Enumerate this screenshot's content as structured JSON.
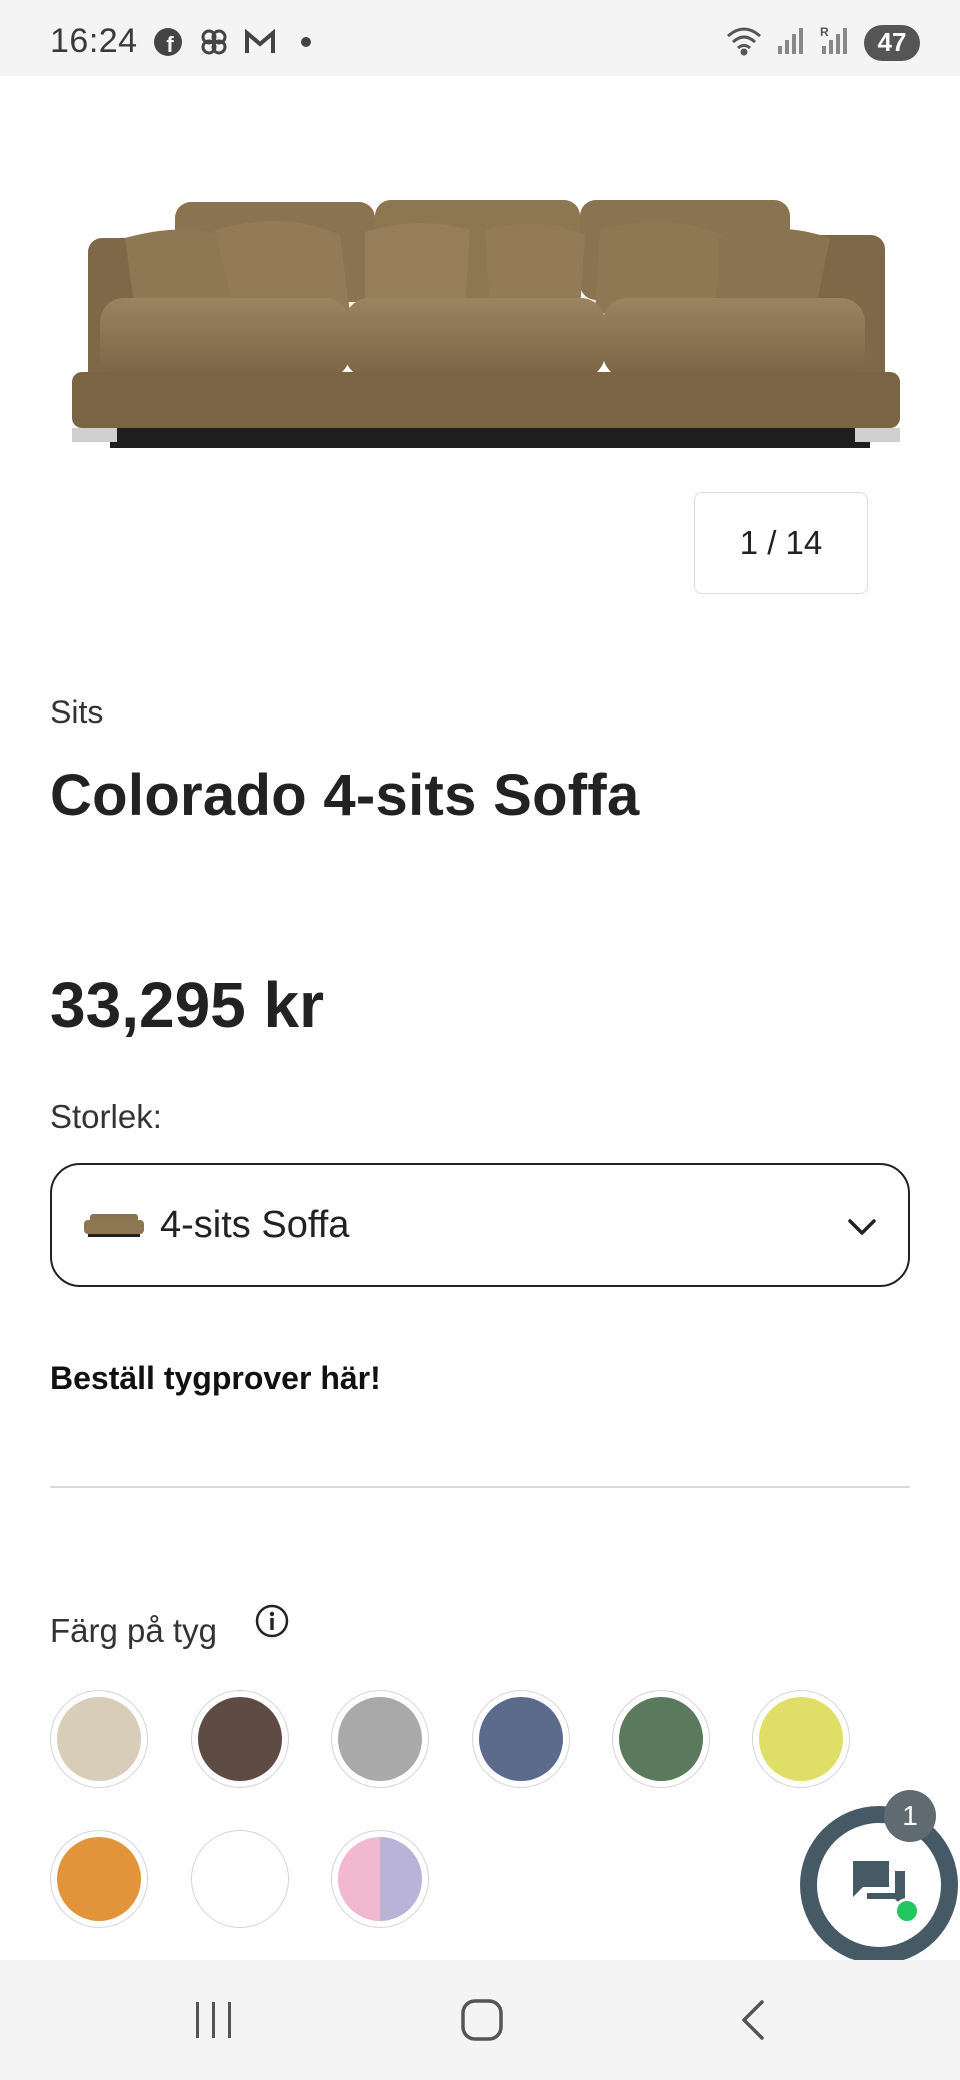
{
  "status_bar": {
    "time": "16:24",
    "left_icons": [
      "facebook-icon",
      "pinwheel-icon",
      "gmail-icon",
      "dot-icon"
    ],
    "right_icons": [
      "wifi-icon",
      "signal-icon",
      "signal-roaming-icon"
    ],
    "battery": "47"
  },
  "product": {
    "image_counter": "1 / 14",
    "category": "Sits",
    "title": "Colorado 4-sits Soffa",
    "price": "33,295 kr",
    "size_label": "Storlek:",
    "size_value": "4-sits Soffa",
    "sample_link": "Beställ tygprover här!",
    "color_label": "Färg på tyg"
  },
  "colors": {
    "swatches": [
      "#d8cdb8",
      "#5e4c44",
      "#a9a9a9",
      "#5c6b8c",
      "#5b7a5d",
      "#dfdf68",
      "#e2943b",
      "#ffffff",
      "split"
    ],
    "split_swatch": [
      "#f2b8d0",
      "#b9b3d8"
    ],
    "sofa": "#8d7652"
  },
  "chat": {
    "badge": "1"
  }
}
